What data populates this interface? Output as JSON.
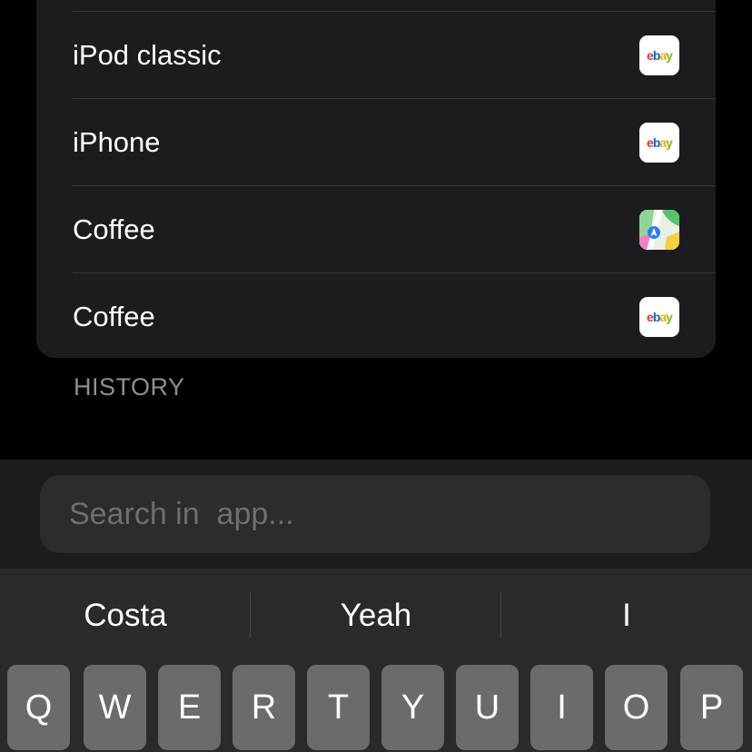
{
  "results": [
    {
      "label": "iPod classic",
      "app_icon": "ebay-icon"
    },
    {
      "label": "iPhone",
      "app_icon": "ebay-icon"
    },
    {
      "label": "Coffee",
      "app_icon": "maps-icon"
    },
    {
      "label": "Coffee",
      "app_icon": "ebay-icon"
    }
  ],
  "ebay_logo": {
    "e": "e",
    "b": "b",
    "a": "a",
    "y": "y"
  },
  "section_header": "HISTORY",
  "search": {
    "placeholder": "Search in  app...",
    "value": ""
  },
  "keyboard": {
    "suggestions": [
      "Costa",
      "Yeah",
      "I"
    ],
    "row1": [
      "Q",
      "W",
      "E",
      "R",
      "T",
      "Y",
      "U",
      "I",
      "O",
      "P"
    ]
  },
  "colors": {
    "background": "#000000",
    "card": "#1c1c1e",
    "key": "#6b6b6e",
    "header_text": "#8e8e93",
    "ebay_red": "#e53238",
    "ebay_blue": "#0064d2",
    "ebay_yellow": "#f5af02",
    "ebay_green": "#86b817"
  }
}
